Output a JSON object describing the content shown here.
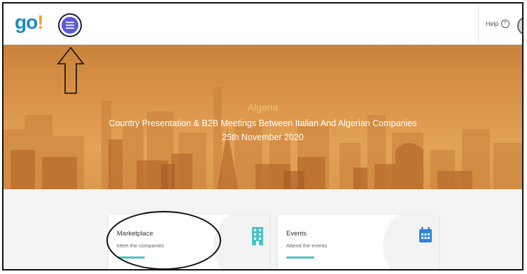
{
  "header": {
    "logo_main": "go",
    "logo_mark": "!",
    "menu_icon": "hamburger-menu-icon",
    "help_label": "Help",
    "help_icon": "question-circle-icon"
  },
  "hero": {
    "country": "Algeria",
    "subtitle": "Country Presentation & B2B Meetings Between Italian And Algerian Companies",
    "date": "25th November 2020"
  },
  "cards": [
    {
      "title": "Marketplace",
      "description": "Meet the companies",
      "icon": "building-icon"
    },
    {
      "title": "Events",
      "description": "Attend the events",
      "icon": "calendar-icon"
    }
  ],
  "colors": {
    "logo_blue": "#1e88c9",
    "logo_accent": "#f4a61d",
    "menu_purple": "#5b5bd6",
    "hero_orange": "#d99247",
    "hero_title": "#f7c56b",
    "teal": "#4bc2c5"
  }
}
